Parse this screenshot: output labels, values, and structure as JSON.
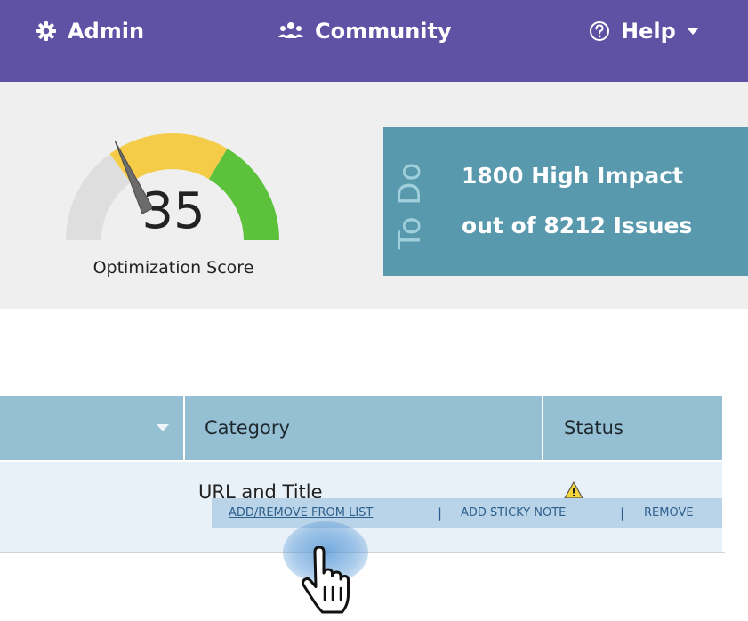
{
  "nav": {
    "admin_label": "Admin",
    "community_label": "Community",
    "help_label": "Help"
  },
  "score": {
    "value": "35",
    "label": "Optimization Score",
    "fraction": 0.35
  },
  "todo": {
    "vertical_label": "To Do",
    "line1": "1800 High Impact",
    "line2": "out of 8212 Issues"
  },
  "table": {
    "col_category": "Category",
    "col_status": "Status",
    "row": {
      "category": "URL and Title",
      "status_icon": "warning-icon"
    },
    "actions": {
      "add_remove": "ADD/REMOVE FROM LIST",
      "sticky": "ADD STICKY NOTE",
      "remove": "REMOVE",
      "separator": "|"
    }
  },
  "colors": {
    "topbar": "#5f51a4",
    "todo_panel": "#5899ad",
    "gauge_low": "#dedede",
    "gauge_mid": "#f5cc48",
    "gauge_high": "#5cc13b",
    "table_header": "#95bfd2"
  },
  "icons": [
    "gear-icon",
    "community-icon",
    "help-circle-icon",
    "caret-down-icon",
    "warning-icon",
    "hand-pointer-icon"
  ]
}
